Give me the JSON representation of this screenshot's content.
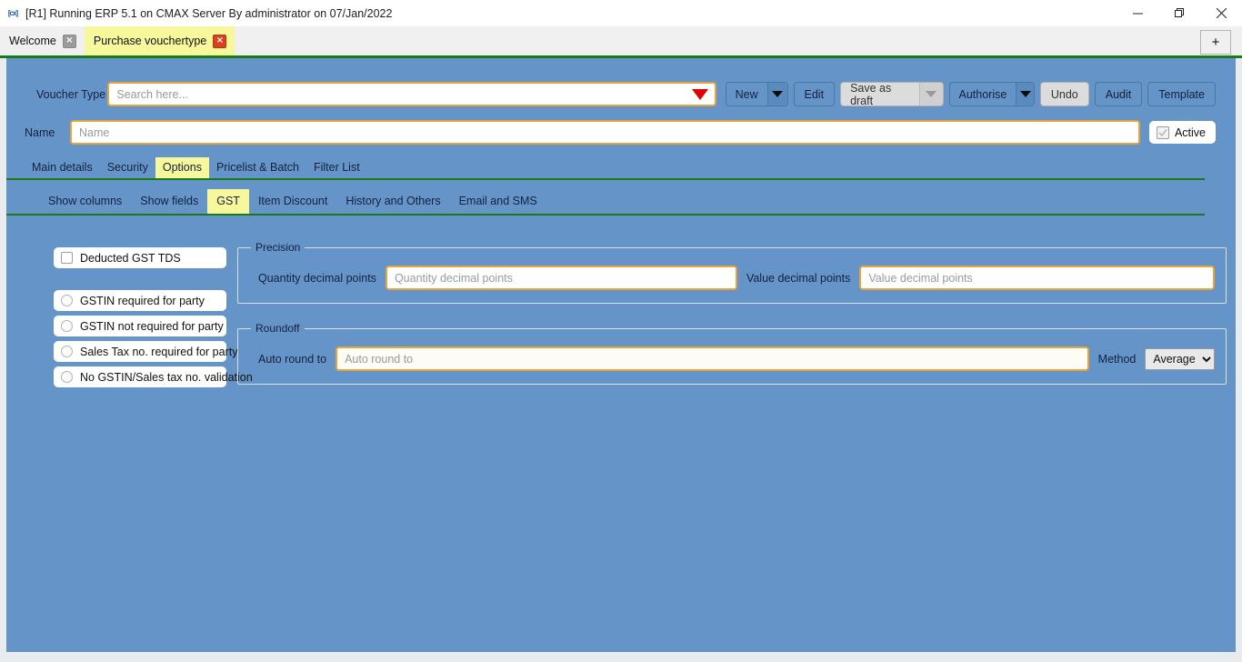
{
  "window": {
    "title": "[R1] Running ERP 5.1 on CMAX Server By administrator on 07/Jan/2022",
    "app_icon": "erp-app-icon",
    "minimize_label": "Minimize",
    "restore_label": "Restore",
    "close_label": "Close"
  },
  "tabstrip": {
    "tabs": [
      {
        "label": "Welcome",
        "active": false,
        "close_label": "×"
      },
      {
        "label": "Purchase vouchertype",
        "active": true,
        "close_label": "×"
      }
    ],
    "new_tab_label": "+"
  },
  "form": {
    "voucher_type_label": "Voucher Type",
    "voucher_type_placeholder": "Search here...",
    "voucher_type_value": "",
    "name_label": "Name",
    "name_placeholder": "Name",
    "name_value": "",
    "active_label": "Active",
    "active_checked": true
  },
  "toolbar": {
    "new_label": "New",
    "edit_label": "Edit",
    "save_as_draft_label": "Save as draft",
    "authorise_label": "Authorise",
    "undo_label": "Undo",
    "audit_label": "Audit",
    "template_label": "Template"
  },
  "main_tabs": [
    {
      "label": "Main details",
      "active": false
    },
    {
      "label": "Security",
      "active": false
    },
    {
      "label": "Options",
      "active": true
    },
    {
      "label": "Pricelist & Batch",
      "active": false
    },
    {
      "label": "Filter List",
      "active": false
    }
  ],
  "sub_tabs": [
    {
      "label": "Show columns",
      "active": false
    },
    {
      "label": "Show fields",
      "active": false
    },
    {
      "label": "GST",
      "active": true
    },
    {
      "label": "Item Discount",
      "active": false
    },
    {
      "label": "History and Others",
      "active": false
    },
    {
      "label": "Email and SMS",
      "active": false
    }
  ],
  "options": {
    "checkbox": {
      "label": "Deducted GST TDS",
      "checked": false
    },
    "radios": [
      {
        "label": "GSTIN required for party",
        "checked": false
      },
      {
        "label": "GSTIN not required for party",
        "checked": false
      },
      {
        "label": "Sales Tax no. required for party",
        "checked": false
      },
      {
        "label": "No GSTIN/Sales tax no. validation",
        "checked": false
      }
    ]
  },
  "precision": {
    "legend": "Precision",
    "quantity_label": "Quantity decimal points",
    "quantity_placeholder": "Quantity decimal points",
    "quantity_value": "",
    "value_label": "Value decimal points",
    "value_placeholder": "Value decimal points",
    "value_value": ""
  },
  "roundoff": {
    "legend": "Roundoff",
    "auto_round_label": "Auto round to",
    "auto_round_placeholder": "Auto round to",
    "auto_round_value": "",
    "method_label": "Method",
    "method_selected": "Average",
    "method_options": [
      "Average"
    ]
  },
  "colors": {
    "canvas_blue": "#6595c8",
    "active_tab_yellow": "#f7f79b",
    "separator_green": "#1a7a1a",
    "input_border_orange": "#e8a33d",
    "dropdown_red": "#e00000"
  }
}
